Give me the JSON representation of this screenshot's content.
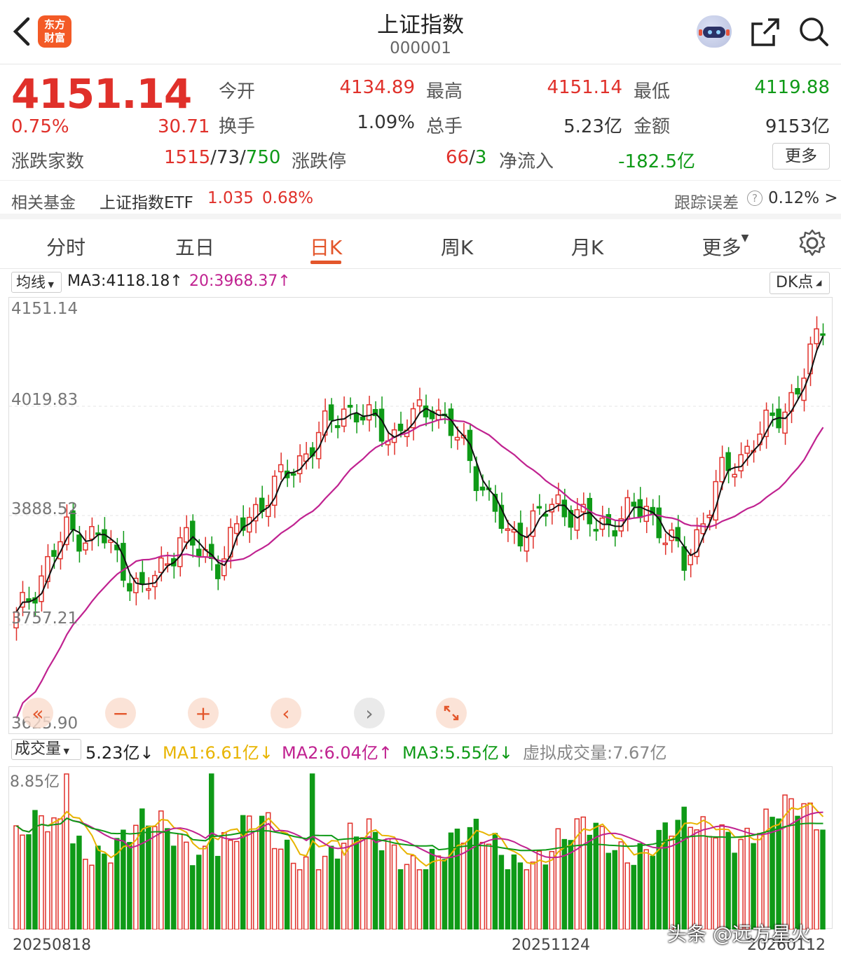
{
  "header": {
    "title": "上证指数",
    "code": "000001",
    "logo_text_1": "东方",
    "logo_text_2": "财富"
  },
  "quote": {
    "price": "4151.14",
    "change_pct": "0.75%",
    "change": "30.71",
    "open_label": "今开",
    "open": "4134.89",
    "high_label": "最高",
    "high": "4151.14",
    "low_label": "最低",
    "low": "4119.88",
    "turnover_label": "换手",
    "turnover": "1.09%",
    "volume_label": "总手",
    "volume": "5.23亿",
    "amount_label": "金额",
    "amount": "9153亿",
    "breadth_label": "涨跌家数",
    "breadth_up": "1515",
    "breadth_flat": "73",
    "breadth_down": "750",
    "sep": "/",
    "limit_label": "涨跌停",
    "limit_up": "66",
    "limit_down": "3",
    "netflow_label": "净流入",
    "netflow": "-182.5亿",
    "more": "更多"
  },
  "fund": {
    "label": "相关基金",
    "name": "上证指数ETF",
    "price": "1.035",
    "pct": "0.68%",
    "tracking_label": "跟踪误差",
    "help": "?",
    "tracking_value": "0.12% >"
  },
  "tabs": [
    {
      "label": "分时"
    },
    {
      "label": "五日"
    },
    {
      "label": "日K"
    },
    {
      "label": "周K"
    },
    {
      "label": "月K"
    },
    {
      "label": "更多"
    }
  ],
  "legend": {
    "ma_select": "均线",
    "ma3": "MA3:4118.18↑",
    "ma20": "20:3968.37↑",
    "dk": "DK点"
  },
  "axis": [
    "4151.14",
    "4019.83",
    "3888.52",
    "3757.21",
    "3625.90"
  ],
  "volume_legend": {
    "select": "成交量",
    "current": "5.23亿↓",
    "ma1": "MA1:6.61亿↓",
    "ma2": "MA2:6.04亿↑",
    "ma3": "MA3:5.55亿↓",
    "virtual": "虚拟成交量:7.67亿",
    "max": "8.85亿"
  },
  "dates": [
    "20250818",
    "20251124",
    "20260112"
  ],
  "watermark": "头条 @远方星火",
  "colors": {
    "up": "#e0302a",
    "down": "#0f9a17",
    "accent": "#e3562b",
    "ma20": "#c02290"
  }
}
